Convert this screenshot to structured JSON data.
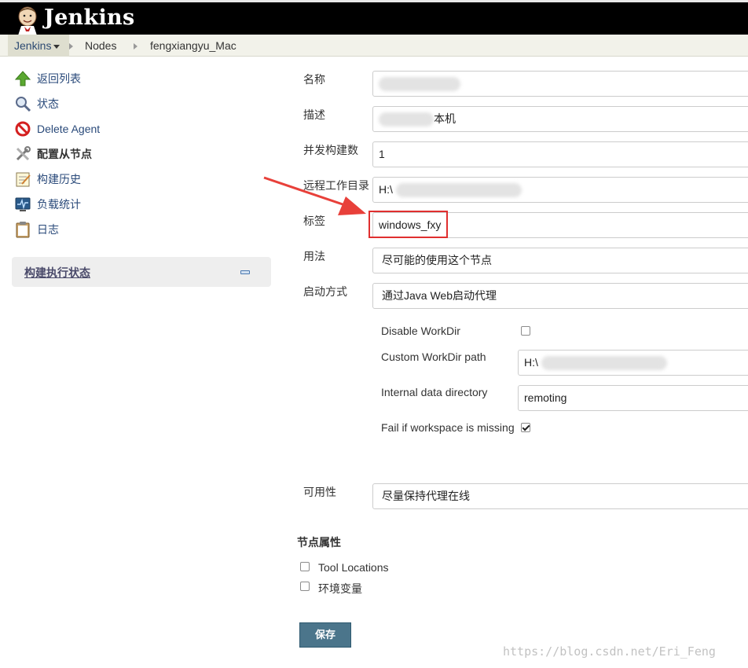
{
  "header": {
    "title": "Jenkins"
  },
  "breadcrumb": {
    "root": "Jenkins",
    "items": [
      "Nodes",
      "fengxiangyu_Mac"
    ]
  },
  "sidebar": {
    "tasks": [
      {
        "label": "返回列表",
        "icon": "up-arrow-icon"
      },
      {
        "label": "状态",
        "icon": "search-icon"
      },
      {
        "label": "Delete Agent",
        "icon": "no-entry-icon"
      },
      {
        "label": "配置从节点",
        "icon": "tools-icon"
      },
      {
        "label": "构建历史",
        "icon": "notepad-icon"
      },
      {
        "label": "负载统计",
        "icon": "monitor-icon"
      },
      {
        "label": "日志",
        "icon": "clipboard-icon"
      }
    ],
    "executor_title": "构建执行状态"
  },
  "form": {
    "name_label": "名称",
    "name_value": "",
    "description_label": "描述",
    "description_value": "本机",
    "executors_label": "并发构建数",
    "executors_value": "1",
    "remote_dir_label": "远程工作目录",
    "remote_dir_value": "H:\\",
    "labels_label": "标签",
    "labels_value": "windows_fxy",
    "usage_label": "用法",
    "usage_value": "尽可能的使用这个节点",
    "launch_label": "启动方式",
    "launch_value": "通过Java Web启动代理",
    "disable_workdir_label": "Disable WorkDir",
    "disable_workdir_checked": false,
    "custom_workdir_label": "Custom WorkDir path",
    "custom_workdir_value": "H:\\",
    "internal_dir_label": "Internal data directory",
    "internal_dir_value": "remoting",
    "fail_missing_label": "Fail if workspace is missing",
    "fail_missing_checked": true,
    "availability_label": "可用性",
    "availability_value": "尽量保持代理在线",
    "node_props_title": "节点属性",
    "tool_locations_label": "Tool Locations",
    "env_vars_label": "环境变量",
    "save_label": "保存"
  },
  "watermark": "https://blog.csdn.net/Eri_Feng",
  "colors": {
    "header_bg": "#000000",
    "breadcrumb_bg": "#f2f2ea",
    "link": "#2a4a7a",
    "highlight": "#e02f2f",
    "save_bg": "#4b758b"
  }
}
